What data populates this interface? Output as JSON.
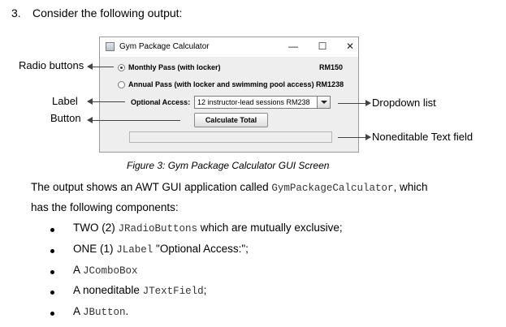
{
  "question": {
    "number": "3.",
    "text": "Consider the following output:"
  },
  "window": {
    "title": "Gym Package Calculator",
    "controls": {
      "minimize": "—",
      "maximize": "☐",
      "close": "✕"
    },
    "radio1": {
      "label": "Monthly Pass (with locker)",
      "price": "RM150",
      "selected": true
    },
    "radio2": {
      "label": "Annual Pass  (with locker and swimming pool access) RM1238",
      "selected": false
    },
    "label": "Optional Access:",
    "combo_value": "12 instructor-lead sessions RM238",
    "button": "Calculate Total",
    "text_field_value": ""
  },
  "annotations": {
    "radio_buttons": "Radio buttons",
    "label": "Label",
    "button": "Button",
    "dropdown": "Dropdown list",
    "textfield": "Noneditable Text field"
  },
  "caption": "Figure 3: Gym Package Calculator GUI Screen",
  "paragraph": {
    "before": "The output shows an AWT GUI application called ",
    "code": "GymPackageCalculator",
    "after1": ", which",
    "line2": "has the following components:"
  },
  "bullets": [
    {
      "pre": "TWO (2) ",
      "code": "JRadioButtons",
      "post": " which are mutually exclusive;"
    },
    {
      "pre": "ONE (1) ",
      "code": "JLabel",
      "post": " \"Optional Access:\";"
    },
    {
      "pre": "A ",
      "code": "JComboBox",
      "post": ""
    },
    {
      "pre": "A noneditable ",
      "code": "JTextField",
      "post": ";"
    },
    {
      "pre": "A ",
      "code": "JButton",
      "post": "."
    }
  ],
  "colors": {
    "window_bg": "#eeeeee",
    "arrow": "#444444"
  }
}
